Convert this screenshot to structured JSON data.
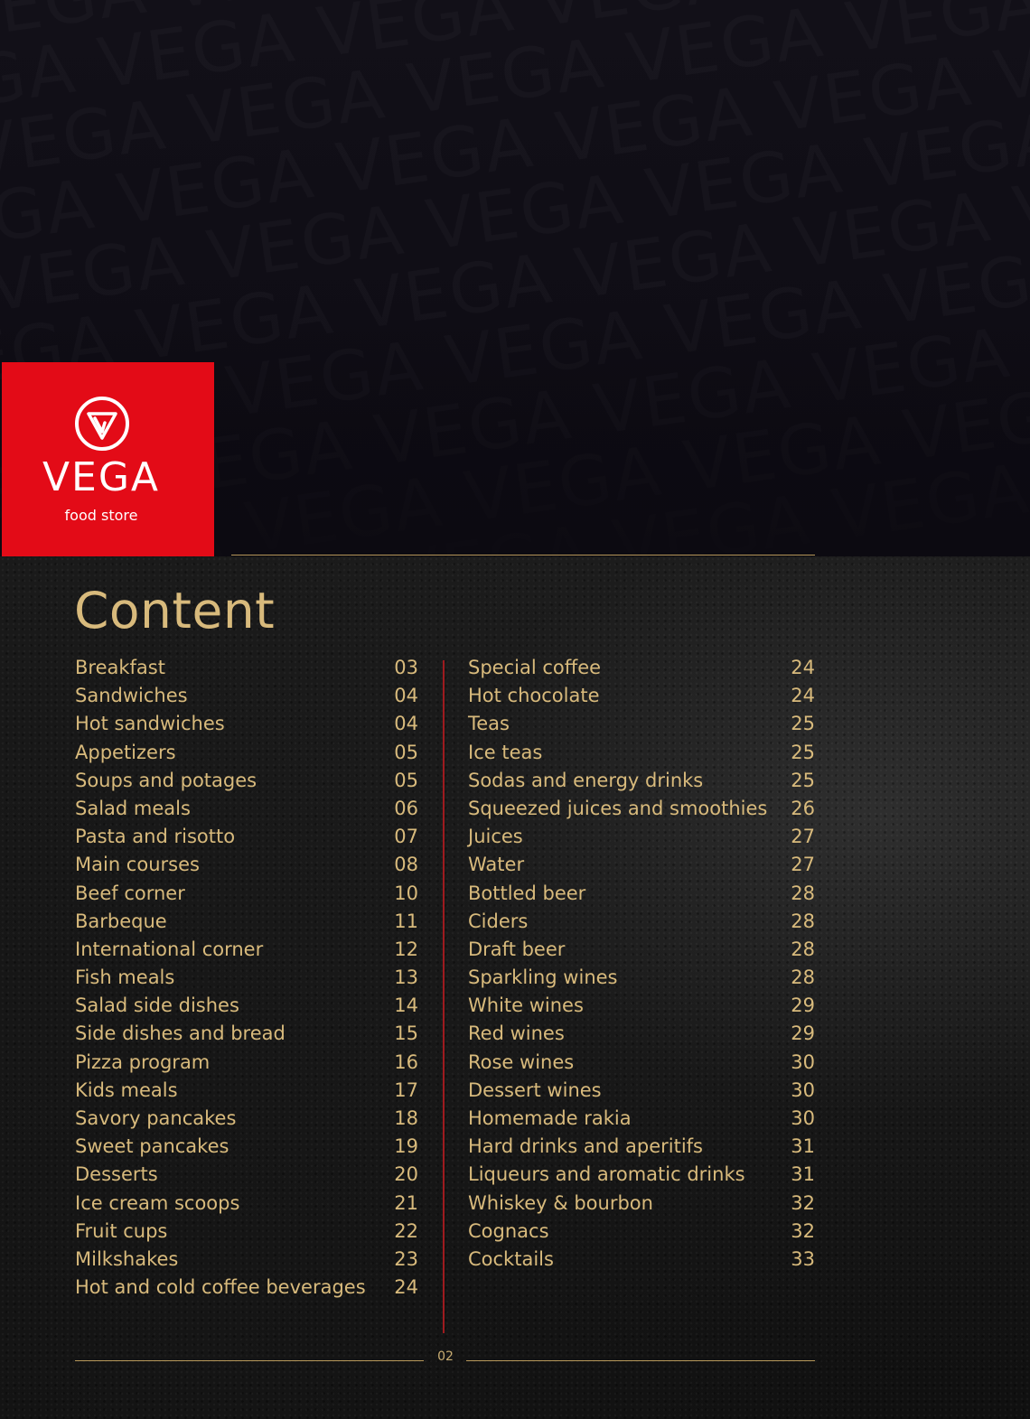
{
  "brand": {
    "wordmark": "VEGA",
    "tagline": "food store",
    "pattern_word": "VEGA",
    "brand_color": "#e30b17"
  },
  "title": "Content",
  "accent_color": "#d8ba7c",
  "divider_color": "#9e1b1f",
  "toc_left": [
    {
      "label": "Breakfast",
      "page": "03"
    },
    {
      "label": "Sandwiches",
      "page": "04"
    },
    {
      "label": "Hot sandwiches",
      "page": "04"
    },
    {
      "label": "Appetizers",
      "page": "05"
    },
    {
      "label": "Soups and potages",
      "page": "05"
    },
    {
      "label": "Salad meals",
      "page": "06"
    },
    {
      "label": "Pasta and risotto",
      "page": "07"
    },
    {
      "label": "Main courses",
      "page": "08"
    },
    {
      "label": "Beef corner",
      "page": "10"
    },
    {
      "label": "Barbeque",
      "page": "11"
    },
    {
      "label": "International corner",
      "page": "12"
    },
    {
      "label": "Fish meals",
      "page": "13"
    },
    {
      "label": "Salad side dishes",
      "page": "14"
    },
    {
      "label": "Side dishes and bread",
      "page": "15"
    },
    {
      "label": "Pizza program",
      "page": "16"
    },
    {
      "label": "Kids meals",
      "page": "17"
    },
    {
      "label": "Savory pancakes",
      "page": "18"
    },
    {
      "label": "Sweet pancakes",
      "page": "19"
    },
    {
      "label": "Desserts",
      "page": "20"
    },
    {
      "label": "Ice cream scoops",
      "page": "21"
    },
    {
      "label": "Fruit cups",
      "page": "22"
    },
    {
      "label": "Milkshakes",
      "page": "23"
    },
    {
      "label": "Hot and cold coffee beverages",
      "page": "24"
    }
  ],
  "toc_right": [
    {
      "label": "Special coffee",
      "page": "24"
    },
    {
      "label": "Hot chocolate",
      "page": "24"
    },
    {
      "label": "Teas",
      "page": "25"
    },
    {
      "label": "Ice teas",
      "page": "25"
    },
    {
      "label": "Sodas and energy drinks",
      "page": "25"
    },
    {
      "label": "Squeezed juices and smoothies",
      "page": "26"
    },
    {
      "label": "Juices",
      "page": "27"
    },
    {
      "label": "Water",
      "page": "27"
    },
    {
      "label": "Bottled beer",
      "page": "28"
    },
    {
      "label": "Ciders",
      "page": "28"
    },
    {
      "label": "Draft beer",
      "page": "28"
    },
    {
      "label": "Sparkling wines",
      "page": "28"
    },
    {
      "label": "White wines",
      "page": "29"
    },
    {
      "label": "Red wines",
      "page": "29"
    },
    {
      "label": "Rose wines",
      "page": "30"
    },
    {
      "label": "Dessert wines",
      "page": "30"
    },
    {
      "label": "Homemade rakia",
      "page": "30"
    },
    {
      "label": "Hard drinks and aperitifs",
      "page": "31"
    },
    {
      "label": "Liqueurs and aromatic drinks",
      "page": "31"
    },
    {
      "label": "Whiskey & bourbon",
      "page": "32"
    },
    {
      "label": "Cognacs",
      "page": "32"
    },
    {
      "label": "Cocktails",
      "page": "33"
    }
  ],
  "page_number": "02"
}
